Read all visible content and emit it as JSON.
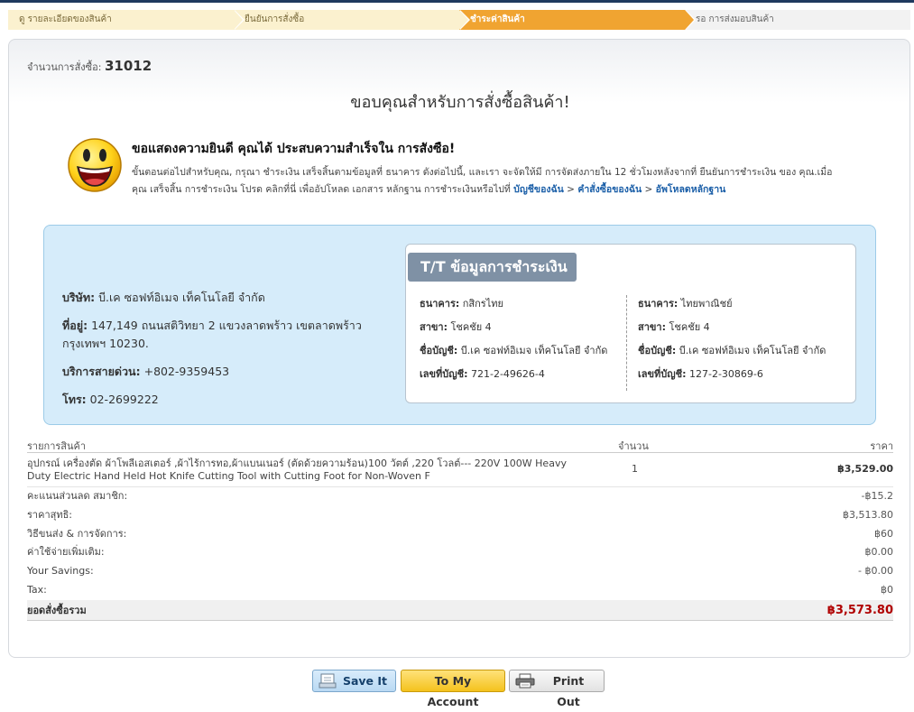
{
  "steps": [
    {
      "label": "ดู รายละเอียดของสินค้า"
    },
    {
      "label": "ยืนยันการสั่งซื้อ"
    },
    {
      "label": "ชำระค่าสินค้า"
    },
    {
      "label": "รอ การส่งมอบสินค้า"
    }
  ],
  "order": {
    "label": "จำนวนการสั่งซื้อ:",
    "number": "31012",
    "thanks": "ขอบคุณสำหรับการสั่งซื้อสินค้า!"
  },
  "message": {
    "title": "ขอแสดงความยินดี คุณได้ ประสบความสำเร็จใน การสังซือ!",
    "body": "ขั้นตอนต่อไปสำหรับคุณ, กรุณา ชำระเงิน เสร็จสิ้นตามข้อมูลที่ ธนาคาร ดังต่อไปนี้, และเรา จะจัดให้มี การจัดส่งภายใน 12 ชั่วโมงหลังจากที่ ยืนยันการชำระเงิน ของ คุณ.เมื่อคุณ เสร็จสิ้น การชำระเงิน โปรด คลิกที่นี่ เพื่ออัปโหลด เอกสาร หลักฐาน การชำระเงินหรือไปที่",
    "link_account": "บัญชีของฉัน",
    "sep1": " > ",
    "link_orders": "คำสั่งซื้อของฉัน",
    "sep2": " > ",
    "link_upload": "อัพโหลดหลักฐาน"
  },
  "company": {
    "name_label": "บริษัท:",
    "name": "บี.เค ซอฟท์อิเมจ เท็คโนโลยี จำกัด",
    "address_label": "ที่อยู่:",
    "address": "147,149 ถนนสติวิทยา 2 แขวงลาดพร้าว เขตลาดพร้าว กรุงเทพฯ 10230.",
    "hotline_label": "บริการสายด่วน:",
    "hotline": "+802-9359453",
    "phone_label": "โทร:",
    "phone": "02-2699222"
  },
  "tt": {
    "title": "T/T ข้อมูลการชำระเงิน",
    "labels": {
      "bank": "ธนาคาร:",
      "branch": "สาขา:",
      "account_name": "ชื่อบัญชี:",
      "account_no": "เลขที่บัญชี:"
    },
    "banks": [
      {
        "bank": "กสิกรไทย",
        "branch": "โชคชัย 4",
        "account_name": "บี.เค ซอฟท์อิเมจ เท็คโนโลยี จำกัด",
        "account_no": "721-2-49626-4"
      },
      {
        "bank": "ไทยพาณิชย์",
        "branch": "โชคชัย 4",
        "account_name": "บี.เค ซอฟท์อิเมจ เท็คโนโลยี จำกัด",
        "account_no": "127-2-30869-6"
      }
    ]
  },
  "items": {
    "headers": {
      "product": "รายการสินค้า",
      "qty": "จำนวน",
      "price": "ราคา"
    },
    "product": {
      "name": "อุปกรณ์ เครื่องตัด ผ้าโพลีเอสเตอร์ ,ผ้าไร้การทอ,ผ้าแบนเนอร์ (ตัดด้วยความร้อน)100 วัตต์ ,220 โวลต์--- 220V 100W Heavy Duty Electric Hand Held Hot Knife Cutting Tool with Cutting Foot for Non-Woven F",
      "qty": "1",
      "price": "฿3,529.00"
    },
    "lines": [
      {
        "label": "คะแนนส่วนลด สมาชิก:",
        "value": "-฿15.2"
      },
      {
        "label": "ราคาสุทธิ:",
        "value": "฿3,513.80"
      },
      {
        "label": "วิธีขนส่ง & การจัดการ:",
        "value": "฿60"
      },
      {
        "label": "ค่าใช้จ่ายเพิ่มเติม:",
        "value": "฿0.00"
      },
      {
        "label": "Your Savings:",
        "value": "- ฿0.00"
      },
      {
        "label": "Tax:",
        "value": "฿0"
      }
    ],
    "total": {
      "label": "ยอดสั่งซื้อรวม",
      "value": "฿3,573.80"
    }
  },
  "buttons": {
    "save": "Save It",
    "account": "To My Account",
    "print": "Print Out"
  },
  "icons": {
    "smiley": "smiley-face-icon",
    "save": "save-document-icon",
    "print": "printer-icon"
  },
  "colors": {
    "active_step": "#f0a431",
    "link": "#1b5fa8",
    "total": "#b00000",
    "info_bg": "#d6ecfa"
  }
}
